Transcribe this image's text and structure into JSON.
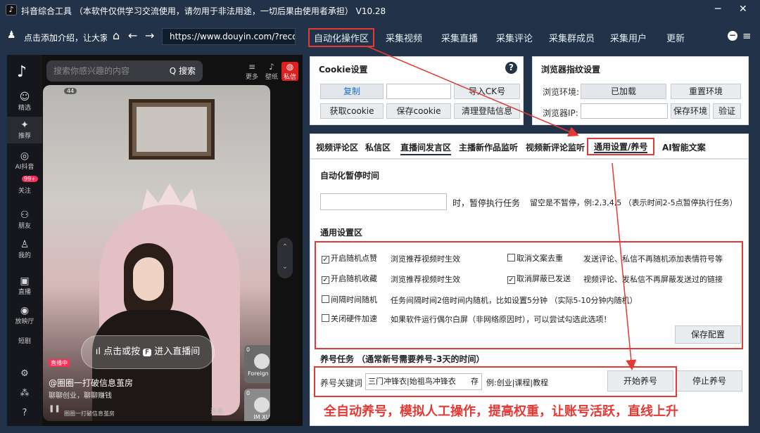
{
  "window": {
    "title": "抖音综合工具 （本软件仅供学习交流使用，请勿用于非法用途，一切后果由使用者承担） V10.28",
    "logo": "♪",
    "min": "─",
    "close": "✕"
  },
  "nav": {
    "profile": "点击添加介绍，让大家认识你...",
    "url": "https://www.douyin.com/?recom",
    "tabs": [
      "自动化操作区",
      "采集视频",
      "采集直播",
      "采集评论",
      "采集群成员",
      "采集用户",
      "更新"
    ],
    "minus": "−",
    "menu": "≡"
  },
  "douyin": {
    "sidebar": [
      {
        "g": "☺",
        "t": "精选"
      },
      {
        "g": "✦",
        "t": "推荐"
      },
      {
        "g": "◎",
        "t": "AI抖音"
      },
      {
        "g": "",
        "t": "关注"
      },
      {
        "g": "⚇",
        "t": "朋友"
      },
      {
        "g": "♙",
        "t": "我的"
      },
      {
        "g": "▣",
        "t": "直播"
      },
      {
        "g": "◉",
        "t": "放映厅"
      },
      {
        "g": "",
        "t": "短剧"
      }
    ],
    "badge": "99+",
    "search_placeholder": "搜索你感兴趣的内容",
    "search_btn": "Q 搜索",
    "top": [
      {
        "g": "≡",
        "t": "更多"
      },
      {
        "g": "♪",
        "t": "壁纸"
      },
      {
        "g": "◍",
        "t": "私信"
      }
    ],
    "video_badge": "44",
    "enter": "点击或按",
    "enter_key": "F",
    "enter_tail": "进入直播间",
    "live": "直播中",
    "title": "@圈圈一打破信息茧房",
    "sub": "聊聊创业，聊聊赚钱",
    "caption": "圈圈一打破信息茧房",
    "lianbo": "连播",
    "side1": {
      "count": "0",
      "name": "Foreign ..."
    },
    "side2": {
      "count": "0",
      "name": "IM XU"
    }
  },
  "cookie": {
    "title": "Cookie设置",
    "help": "?",
    "copy": "复制",
    "import": "导入CK号",
    "get": "获取cookie",
    "save": "保存cookie",
    "clear": "清理登陆信息"
  },
  "fingerprint": {
    "title": "浏览器指纹设置",
    "env_label": "浏览环境:",
    "env_value": "已加载",
    "reset": "重置环境",
    "ip_label": "浏览器IP:",
    "save_env": "保存环境",
    "verify": "验证"
  },
  "tabs": [
    "视频评论区",
    "私信区",
    "直播间发言区",
    "主播新作品监听",
    "视频新评论监听",
    "通用设置/养号",
    "AI智能文案"
  ],
  "pause": {
    "title": "自动化暂停时间",
    "unit": "时，暂停执行任务",
    "hint": "留空是不暂停，例:2,3,4,5 （表示时间2-5点暂停执行任务）"
  },
  "general": {
    "title": "通用设置区",
    "items": [
      {
        "label": "开启随机点赞",
        "checked": true,
        "desc": "浏览推荐视频时生效"
      },
      {
        "label": "取消文案去重",
        "checked": false,
        "desc": "发送评论、私信不再随机添加表情符号等"
      },
      {
        "label": "开启随机收藏",
        "checked": true,
        "desc": "浏览推荐视频时生效"
      },
      {
        "label": "取消屏蔽已发送",
        "checked": true,
        "desc": "视频评论、发私信不再屏蔽发送过的链接"
      },
      {
        "label": "间隔时间随机",
        "checked": false,
        "desc": "任务间隔时间2倍时间内随机，比如设置5分钟 （实际5-10分钟内随机）"
      },
      {
        "label": "关闭硬件加速",
        "checked": false,
        "desc": "如果软件运行偶尔白屏（非网络原因时），可以尝试勾选此选项！"
      }
    ],
    "save": "保存配置"
  },
  "nurture": {
    "title": "养号任务 （通常新号需要养号-3天的时间）",
    "kw_label": "养号关键词",
    "kw_value": "三门冲锋衣|始祖鸟冲锋衣",
    "save_kw": "存",
    "example": "例:创业|课程|教程",
    "start": "开始养号",
    "stop": "停止养号"
  },
  "slogan": "全自动养号，模拟人工操作，提高权重，让账号活跃，直线上升",
  "colors": {
    "bg": "#223349",
    "accent": "#e53935"
  }
}
